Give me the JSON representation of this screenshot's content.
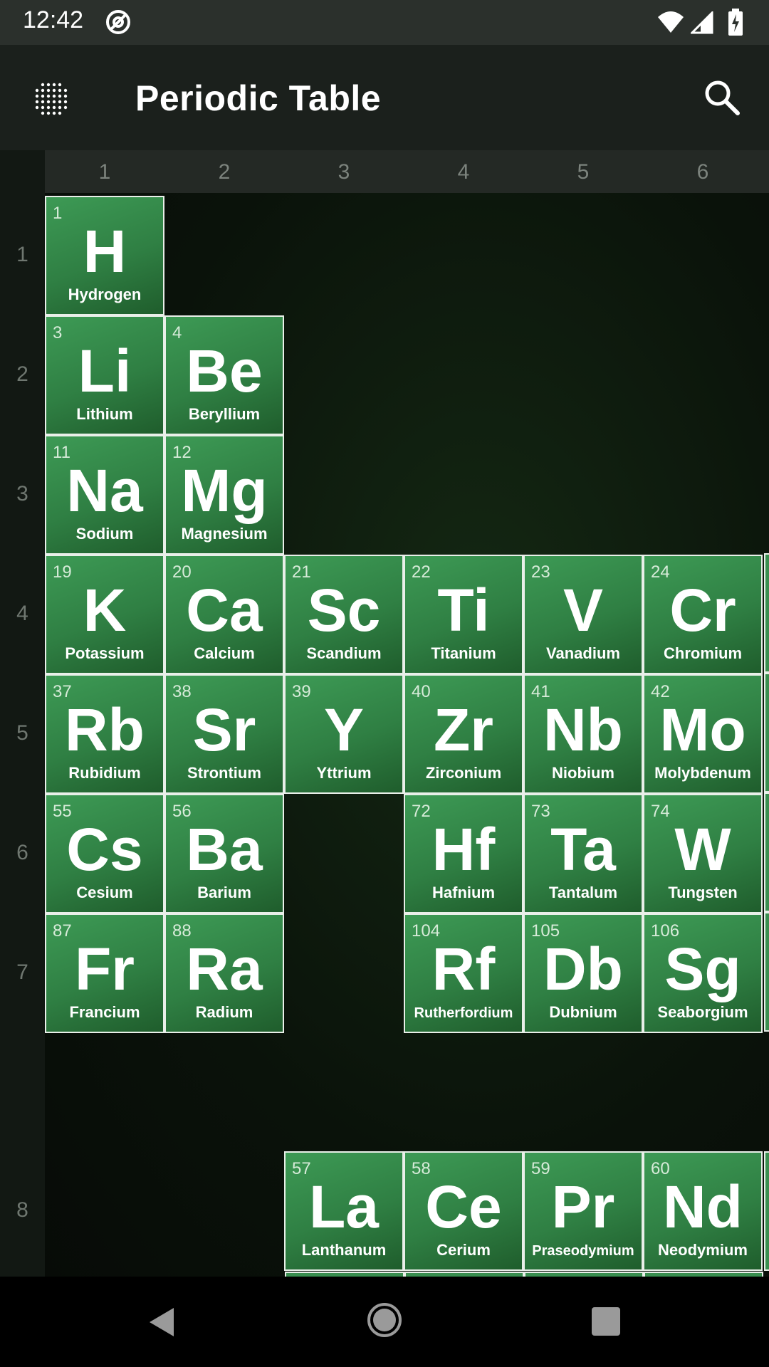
{
  "status_bar": {
    "time": "12:42",
    "icons": [
      "at-sign-icon",
      "wifi-icon",
      "signal-icon",
      "battery-charging-icon"
    ]
  },
  "app_bar": {
    "title": "Periodic Table",
    "menu_icon": "grid-dots-icon",
    "search_icon": "search-icon"
  },
  "table": {
    "columns": [
      "1",
      "2",
      "3",
      "4",
      "5",
      "6"
    ],
    "rows": [
      "1",
      "2",
      "3",
      "4",
      "5",
      "6",
      "7",
      "8"
    ],
    "elements": [
      {
        "number": "1",
        "symbol": "H",
        "name": "Hydrogen"
      },
      {
        "number": "3",
        "symbol": "Li",
        "name": "Lithium"
      },
      {
        "number": "4",
        "symbol": "Be",
        "name": "Beryllium"
      },
      {
        "number": "11",
        "symbol": "Na",
        "name": "Sodium"
      },
      {
        "number": "12",
        "symbol": "Mg",
        "name": "Magnesium"
      },
      {
        "number": "19",
        "symbol": "K",
        "name": "Potassium"
      },
      {
        "number": "20",
        "symbol": "Ca",
        "name": "Calcium"
      },
      {
        "number": "21",
        "symbol": "Sc",
        "name": "Scandium"
      },
      {
        "number": "22",
        "symbol": "Ti",
        "name": "Titanium"
      },
      {
        "number": "23",
        "symbol": "V",
        "name": "Vanadium"
      },
      {
        "number": "24",
        "symbol": "Cr",
        "name": "Chromium"
      },
      {
        "number": "37",
        "symbol": "Rb",
        "name": "Rubidium"
      },
      {
        "number": "38",
        "symbol": "Sr",
        "name": "Strontium"
      },
      {
        "number": "39",
        "symbol": "Y",
        "name": "Yttrium"
      },
      {
        "number": "40",
        "symbol": "Zr",
        "name": "Zirconium"
      },
      {
        "number": "41",
        "symbol": "Nb",
        "name": "Niobium"
      },
      {
        "number": "42",
        "symbol": "Mo",
        "name": "Molybdenum"
      },
      {
        "number": "55",
        "symbol": "Cs",
        "name": "Cesium"
      },
      {
        "number": "56",
        "symbol": "Ba",
        "name": "Barium"
      },
      {
        "number": "72",
        "symbol": "Hf",
        "name": "Hafnium"
      },
      {
        "number": "73",
        "symbol": "Ta",
        "name": "Tantalum"
      },
      {
        "number": "74",
        "symbol": "W",
        "name": "Tungsten"
      },
      {
        "number": "87",
        "symbol": "Fr",
        "name": "Francium"
      },
      {
        "number": "88",
        "symbol": "Ra",
        "name": "Radium"
      },
      {
        "number": "104",
        "symbol": "Rf",
        "name": "Rutherfordium"
      },
      {
        "number": "105",
        "symbol": "Db",
        "name": "Dubnium"
      },
      {
        "number": "106",
        "symbol": "Sg",
        "name": "Seaborgium"
      },
      {
        "number": "57",
        "symbol": "La",
        "name": "Lanthanum"
      },
      {
        "number": "58",
        "symbol": "Ce",
        "name": "Cerium"
      },
      {
        "number": "59",
        "symbol": "Pr",
        "name": "Praseodymium"
      },
      {
        "number": "60",
        "symbol": "Nd",
        "name": "Neodymium"
      }
    ]
  },
  "nav_bar": {
    "back_icon": "back-triangle-icon",
    "home_icon": "home-circle-icon",
    "recents_icon": "recents-square-icon"
  },
  "colors": {
    "tile_green": "#2f7f43",
    "tile_border": "#e9efe9",
    "app_bar": "#1b201c",
    "status_bar": "#2b302c"
  }
}
